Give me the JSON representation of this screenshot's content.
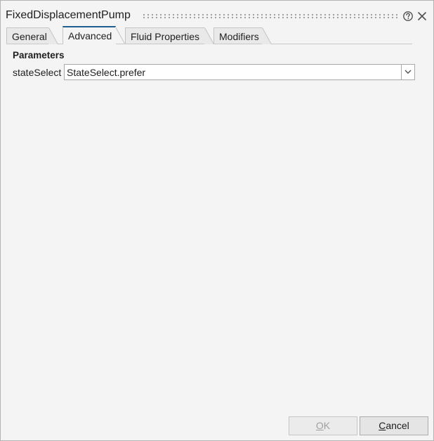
{
  "window": {
    "title": "FixedDisplacementPump",
    "help_icon": "question-circle-icon",
    "close_icon": "close-icon"
  },
  "tabs": [
    {
      "label": "General",
      "active": false
    },
    {
      "label": "Advanced",
      "active": true
    },
    {
      "label": "Fluid Properties",
      "active": false
    },
    {
      "label": "Modifiers",
      "active": false
    }
  ],
  "section": {
    "title": "Parameters"
  },
  "parameters": [
    {
      "name": "stateSelect",
      "value": "StateSelect.prefer"
    }
  ],
  "buttons": {
    "ok": {
      "mnemonic": "O",
      "rest": "K",
      "enabled": false
    },
    "cancel": {
      "mnemonic": "C",
      "rest": "ancel",
      "enabled": true
    }
  },
  "colors": {
    "active_tab_accent": "#1f5f8f",
    "background": "#f4f4f4"
  }
}
